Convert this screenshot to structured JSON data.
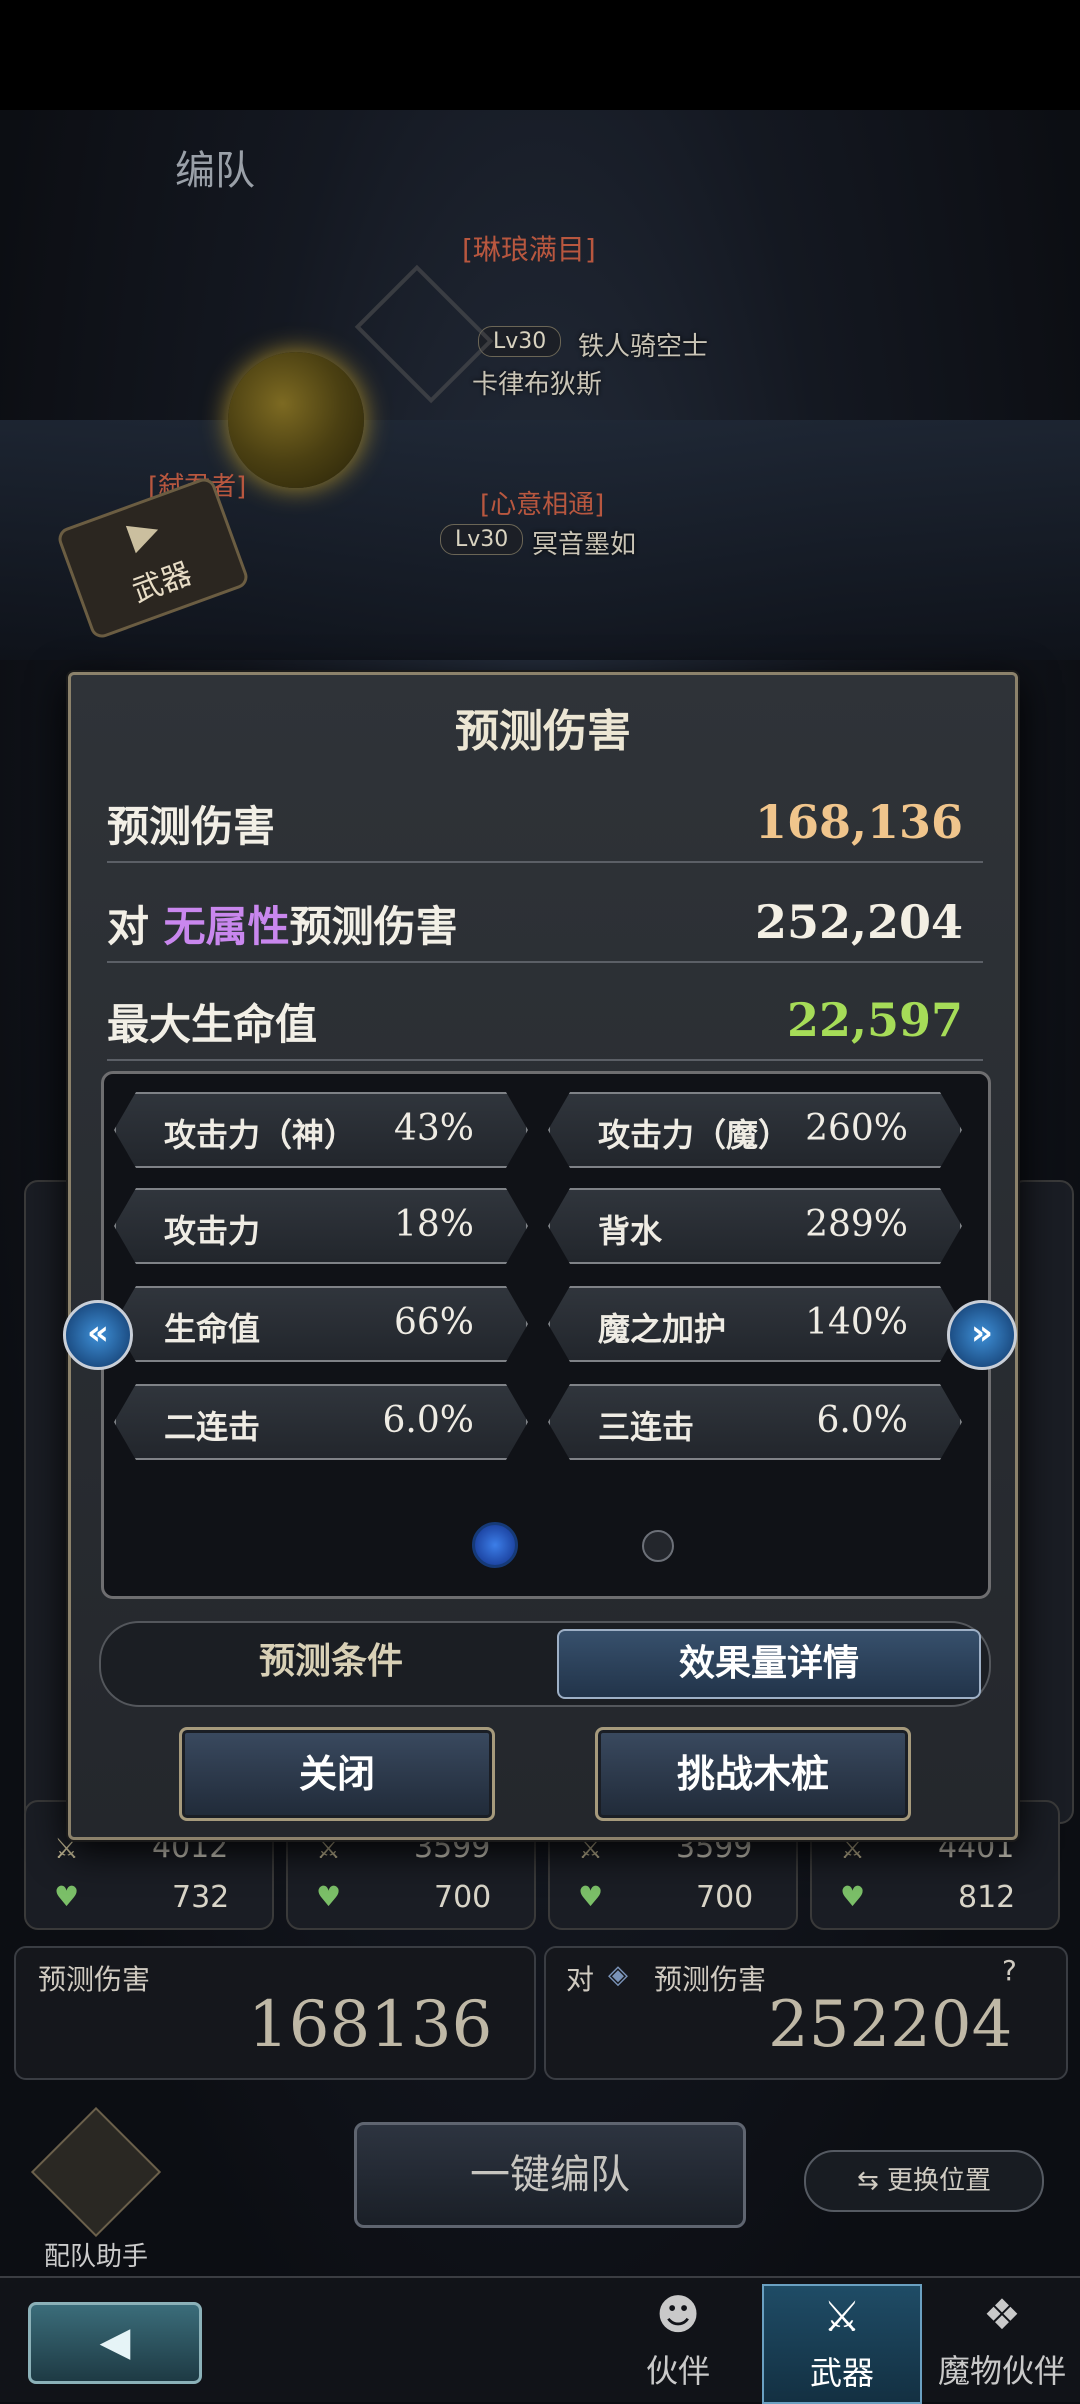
{
  "page": {
    "title": "编队"
  },
  "scene": {
    "character_top": {
      "title": "[琳琅满目]",
      "level": "Lv30",
      "name_right": "铁人骑空士",
      "name_below": "卡律布狄斯"
    },
    "character_mid": {
      "title": "[心意相通]",
      "level": "Lv30",
      "name": "冥音墨如"
    },
    "character_left": {
      "title": "[弑君者]"
    },
    "weapon_badge": "武器"
  },
  "modal": {
    "title": "预测伤害",
    "stats": [
      {
        "label": "预测伤害",
        "value": "168,136",
        "color": "#f0c58c"
      },
      {
        "label_prefix": "对",
        "label_highlight": "无属性",
        "label_suffix": "预测伤害",
        "value": "252,204",
        "color": "#f3efe4"
      },
      {
        "label": "最大生命值",
        "value": "22,597",
        "color": "#a6dc58"
      }
    ],
    "details": [
      {
        "name": "攻击力（神）",
        "value": "43%"
      },
      {
        "name": "攻击力（魔）",
        "value": "260%"
      },
      {
        "name": "攻击力",
        "value": "18%"
      },
      {
        "name": "背水",
        "value": "289%"
      },
      {
        "name": "生命值",
        "value": "66%"
      },
      {
        "name": "魔之加护",
        "value": "140%"
      },
      {
        "name": "二连击",
        "value": "6.0%"
      },
      {
        "name": "三连击",
        "value": "6.0%"
      }
    ],
    "page_index": 1,
    "page_count": 2,
    "tabs": {
      "conditions": "预测条件",
      "effects": "效果量详情"
    },
    "buttons": {
      "close": "关闭",
      "challenge": "挑战木桩"
    }
  },
  "behind": {
    "cards": [
      {
        "atk": "4012",
        "hp": "732"
      },
      {
        "atk": "3599",
        "hp": "700"
      },
      {
        "atk": "3599",
        "hp": "700"
      },
      {
        "atk": "4401",
        "hp": "812"
      }
    ],
    "prediction": {
      "label": "预测伤害",
      "value": "168136"
    },
    "prediction_vs": {
      "prefix": "对",
      "label": "预测伤害",
      "value": "252204",
      "help": "?"
    },
    "one_click": "一键编队",
    "swap": "更换位置",
    "helper": "配队助手"
  },
  "bottom_nav": {
    "tabs": [
      {
        "label": "伙伴",
        "icon": "person-icon"
      },
      {
        "label": "武器",
        "icon": "swords-icon",
        "active": true
      },
      {
        "label": "魔物伙伴",
        "icon": "monster-icon"
      }
    ]
  }
}
